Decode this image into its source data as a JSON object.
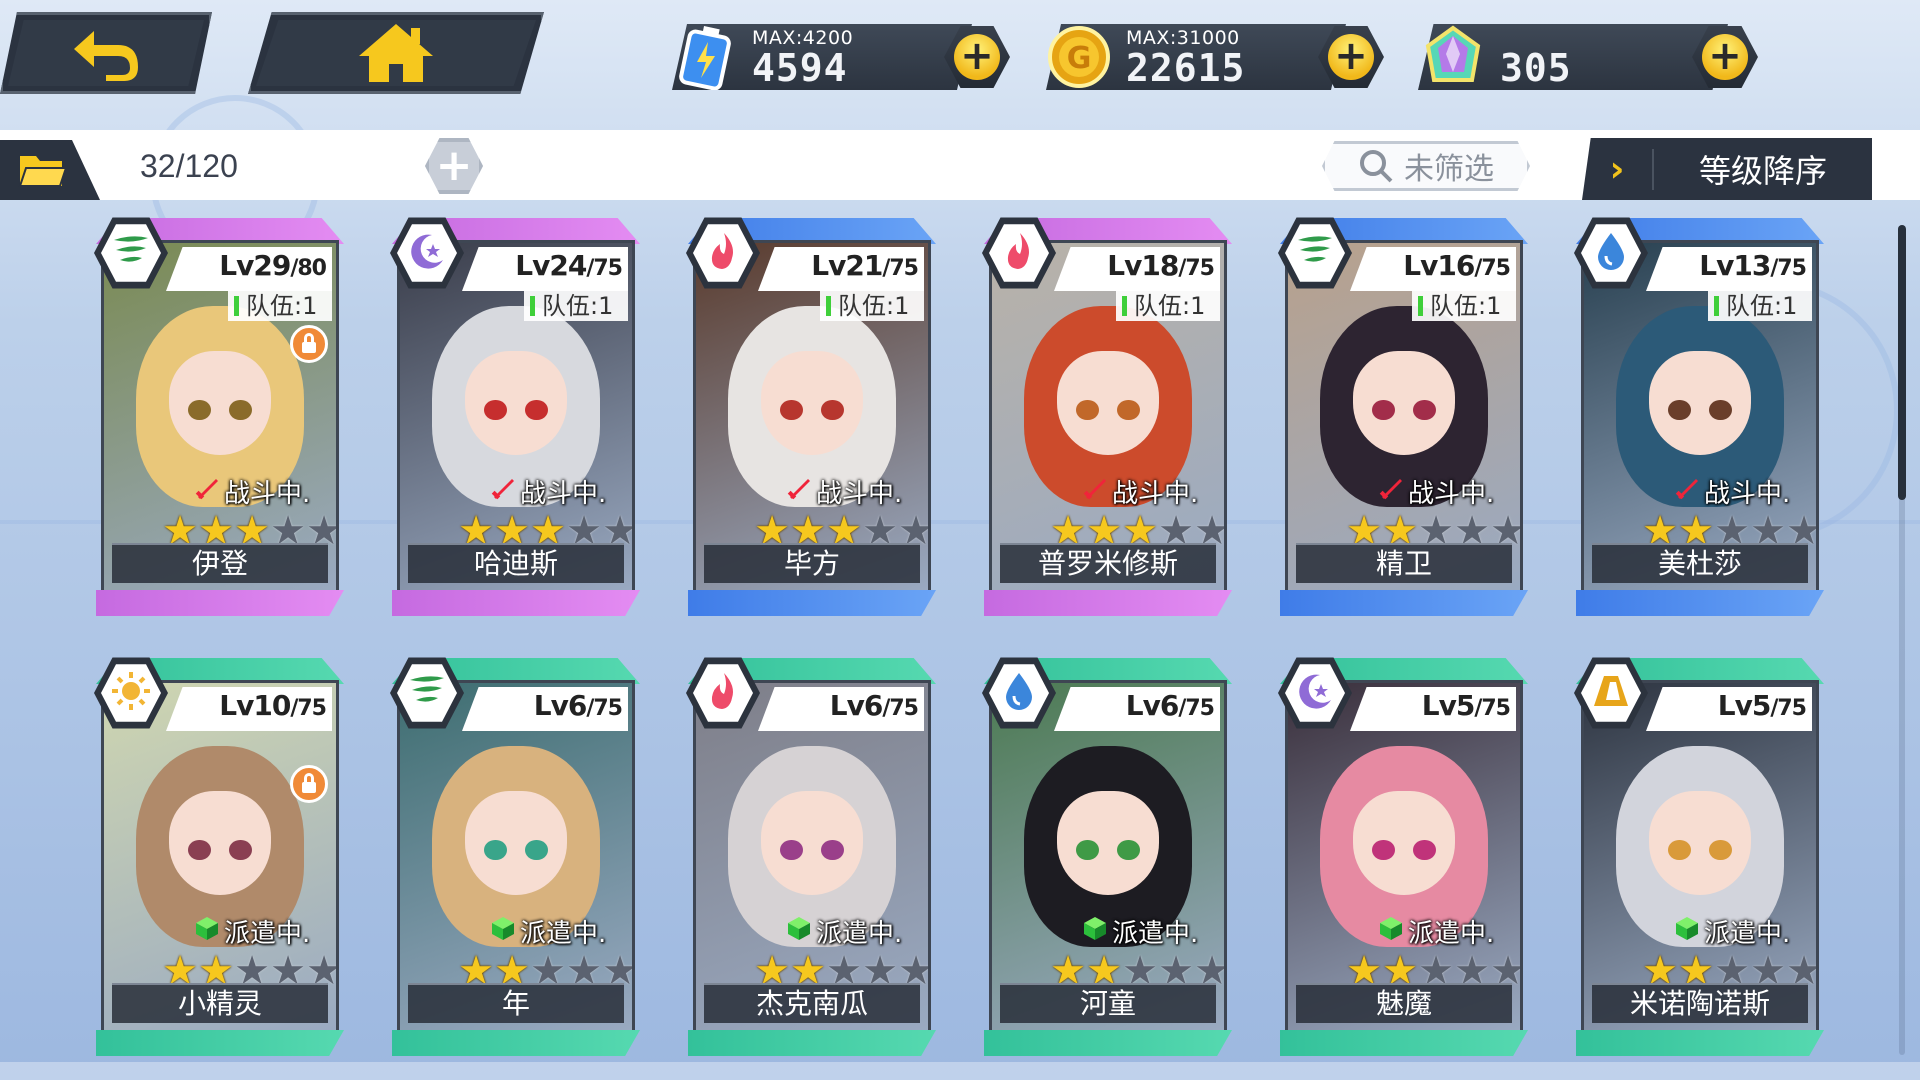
{
  "top_bar": {
    "back_icon": "back-arrow-icon",
    "home_icon": "home-icon",
    "resources": [
      {
        "icon": "stamina-battery-icon",
        "max_label": "MAX:4200",
        "value": "4594"
      },
      {
        "icon": "gold-coin-icon",
        "max_label": "MAX:31000",
        "value": "22615"
      },
      {
        "icon": "crystal-gem-icon",
        "max_label": "",
        "value": "305"
      }
    ],
    "plus_label": "+"
  },
  "toolbar": {
    "folder_icon": "folder-icon",
    "count": "32/120",
    "add_slot_label": "+",
    "filter_label": "未筛选",
    "sort_arrow": "›",
    "sort_label": "等级降序"
  },
  "colors": {
    "purple_frame": "#c56ae0",
    "blue_frame": "#3f7ce8",
    "green_frame": "#33c19a",
    "star_on": "#f6c81e",
    "star_off": "#5b6270"
  },
  "cards": [
    {
      "name": "伊登",
      "level": "Lv29",
      "max_level": "/80",
      "team": "队伍:1",
      "status": "战斗中.",
      "status_icon": "battle-sword-icon",
      "stars": 3,
      "element": "wind-icon",
      "locked": true,
      "frame": "purple"
    },
    {
      "name": "哈迪斯",
      "level": "Lv24",
      "max_level": "/75",
      "team": "队伍:1",
      "status": "战斗中.",
      "status_icon": "battle-sword-icon",
      "stars": 3,
      "element": "moon-icon",
      "locked": false,
      "frame": "purple"
    },
    {
      "name": "毕方",
      "level": "Lv21",
      "max_level": "/75",
      "team": "队伍:1",
      "status": "战斗中.",
      "status_icon": "battle-sword-icon",
      "stars": 3,
      "element": "fire-icon",
      "locked": false,
      "frame": "blue"
    },
    {
      "name": "普罗米修斯",
      "level": "Lv18",
      "max_level": "/75",
      "team": "队伍:1",
      "status": "战斗中.",
      "status_icon": "battle-sword-icon",
      "stars": 3,
      "element": "fire-icon",
      "locked": false,
      "frame": "purple"
    },
    {
      "name": "精卫",
      "level": "Lv16",
      "max_level": "/75",
      "team": "队伍:1",
      "status": "战斗中.",
      "status_icon": "battle-sword-icon",
      "stars": 2,
      "element": "wind-icon",
      "locked": false,
      "frame": "blue"
    },
    {
      "name": "美杜莎",
      "level": "Lv13",
      "max_level": "/75",
      "team": "队伍:1",
      "status": "战斗中.",
      "status_icon": "battle-sword-icon",
      "stars": 2,
      "element": "water-icon",
      "locked": false,
      "frame": "blue"
    },
    {
      "name": "小精灵",
      "level": "Lv10",
      "max_level": "/75",
      "team": "",
      "status": "派遣中.",
      "status_icon": "dispatch-cube-icon",
      "stars": 2,
      "element": "light-sun-icon",
      "locked": true,
      "frame": "green"
    },
    {
      "name": "年",
      "level": "Lv6",
      "max_level": "/75",
      "team": "",
      "status": "派遣中.",
      "status_icon": "dispatch-cube-icon",
      "stars": 2,
      "element": "wind-icon",
      "locked": false,
      "frame": "green"
    },
    {
      "name": "杰克南瓜",
      "level": "Lv6",
      "max_level": "/75",
      "team": "",
      "status": "派遣中.",
      "status_icon": "dispatch-cube-icon",
      "stars": 2,
      "element": "fire-icon",
      "locked": false,
      "frame": "green"
    },
    {
      "name": "河童",
      "level": "Lv6",
      "max_level": "/75",
      "team": "",
      "status": "派遣中.",
      "status_icon": "dispatch-cube-icon",
      "stars": 2,
      "element": "water-icon",
      "locked": false,
      "frame": "green"
    },
    {
      "name": "魅魔",
      "level": "Lv5",
      "max_level": "/75",
      "team": "",
      "status": "派遣中.",
      "status_icon": "dispatch-cube-icon",
      "stars": 2,
      "element": "moon-icon",
      "locked": false,
      "frame": "green"
    },
    {
      "name": "米诺陶诺斯",
      "level": "Lv5",
      "max_level": "/75",
      "team": "",
      "status": "派遣中.",
      "status_icon": "dispatch-cube-icon",
      "stars": 2,
      "element": "earth-icon",
      "locked": false,
      "frame": "green"
    }
  ]
}
